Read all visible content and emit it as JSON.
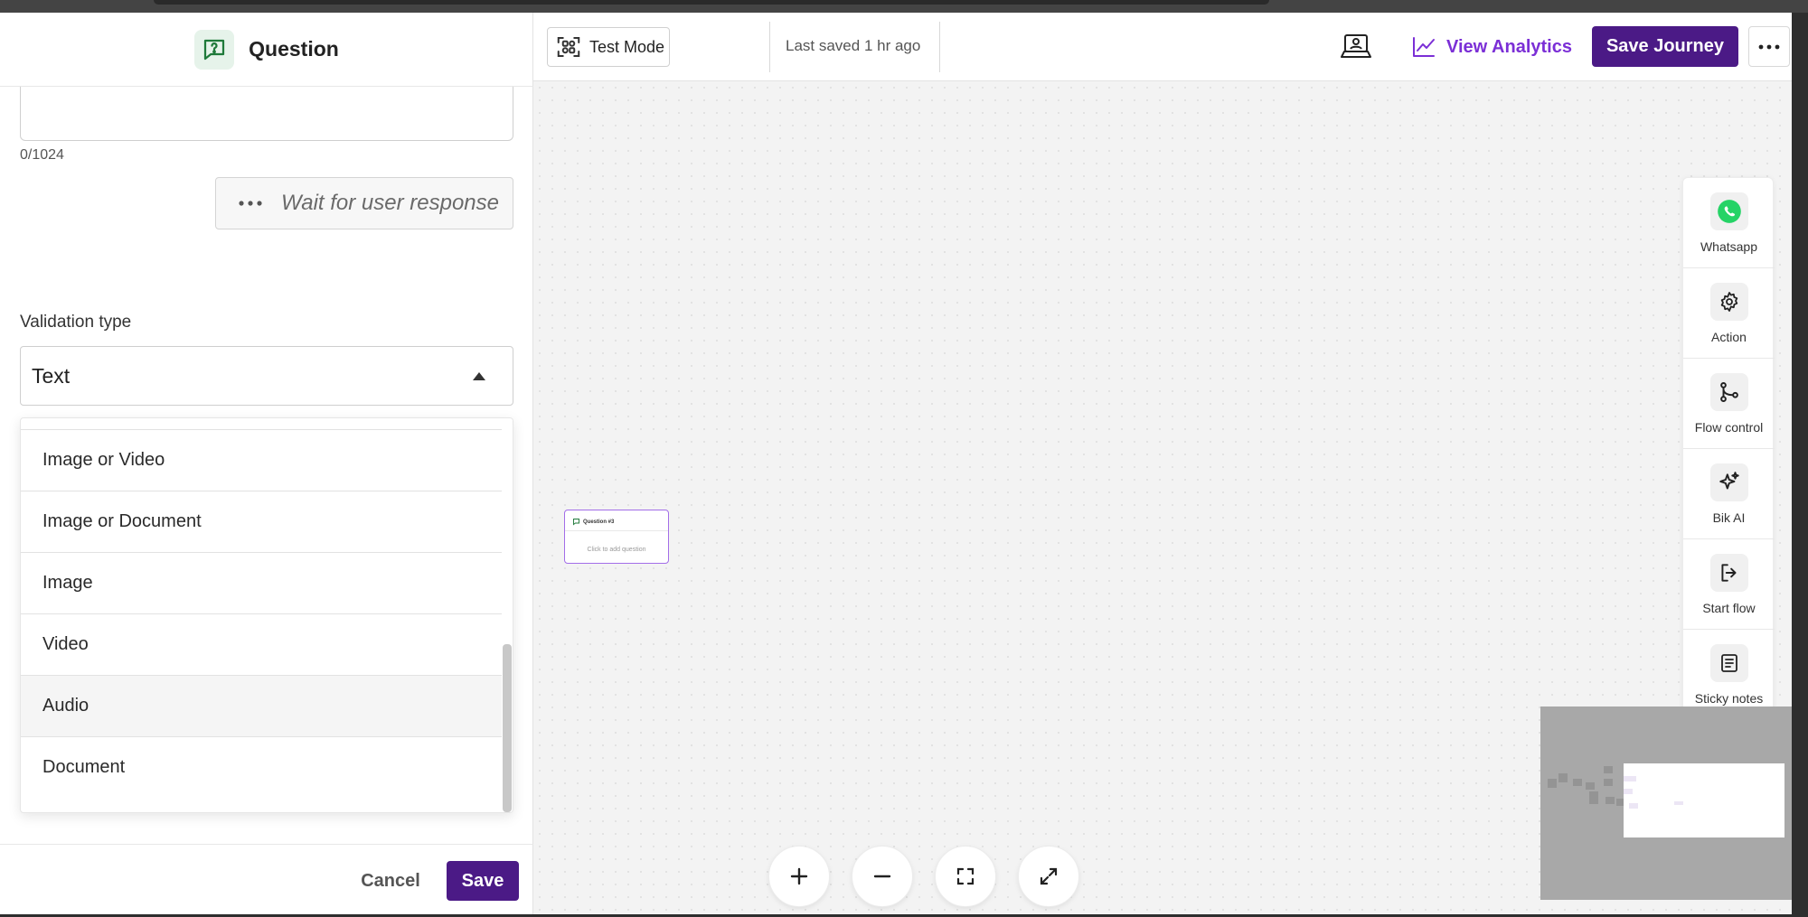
{
  "panel": {
    "title": "Question",
    "char_count": "0/1024",
    "wait_text": "Wait for user response",
    "validation_label": "Validation type",
    "validation_value": "Text",
    "options": [
      "Image or Video",
      "Image or Document",
      "Image",
      "Video",
      "Audio",
      "Document"
    ],
    "cancel_label": "Cancel",
    "save_label": "Save"
  },
  "toolbar": {
    "test_mode": "Test Mode",
    "last_saved": "Last saved 1 hr ago",
    "analytics": "View Analytics",
    "save_journey": "Save Journey"
  },
  "canvas": {
    "node": {
      "title": "Question #3",
      "subtitle": "Click to add question"
    }
  },
  "palette": {
    "items": [
      "Whatsapp",
      "Action",
      "Flow control",
      "Bik AI",
      "Start flow",
      "Sticky notes"
    ]
  },
  "colors": {
    "primary": "#4b1a86",
    "accent": "#7b2fd6",
    "whatsapp": "#25d366",
    "question_green": "#1f7a3a"
  },
  "icons": {
    "question": "question-chat-icon",
    "test_mode": "scan-icon",
    "laptop": "laptop-user-icon",
    "analytics": "line-chart-icon",
    "more": "more-horizontal-icon",
    "zoom_in": "plus-icon",
    "zoom_out": "minus-icon",
    "fit": "fit-view-icon",
    "fullscreen": "expand-icon"
  }
}
